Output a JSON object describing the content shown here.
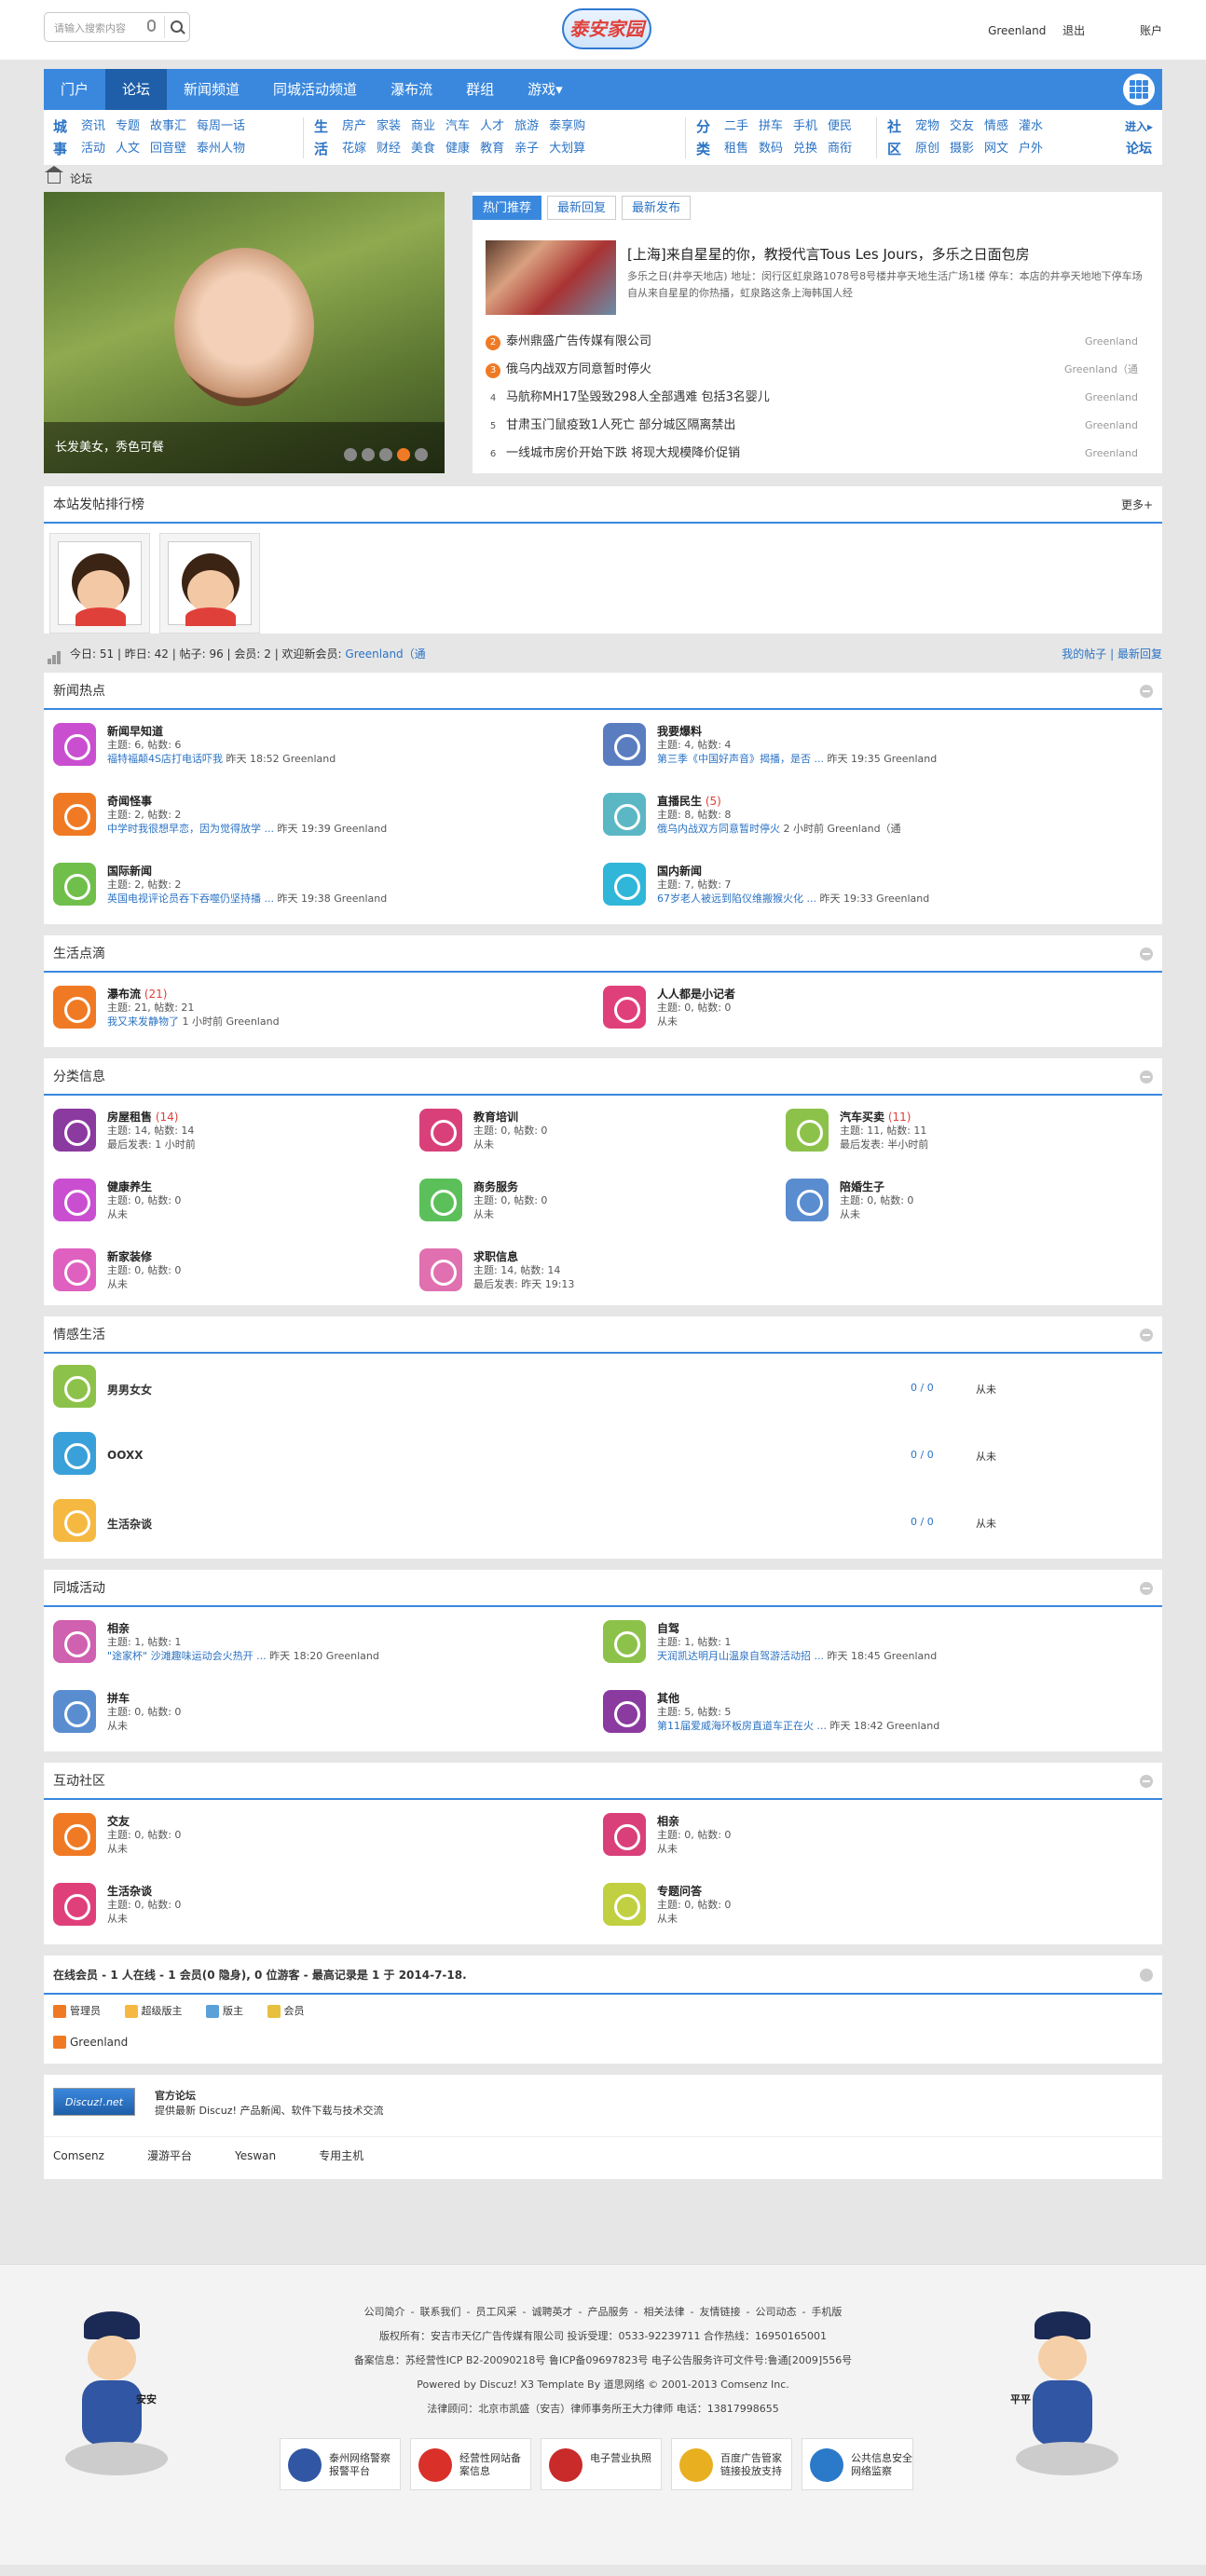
{
  "header": {
    "search_placeholder": "请输入搜索内容",
    "logo": "泰安家园",
    "user": "Greenland",
    "logout": "退出",
    "account": "账户"
  },
  "nav": {
    "items": [
      "门户",
      "论坛",
      "新闻频道",
      "同城活动频道",
      "瀑布流",
      "群组",
      "游戏▾"
    ],
    "active": 1
  },
  "subnav": [
    {
      "label": [
        "城",
        "事"
      ],
      "rows": [
        [
          "资讯",
          "专题",
          "故事汇",
          "每周一话"
        ],
        [
          "活动",
          "人文",
          "回音壁",
          "泰州人物"
        ]
      ]
    },
    {
      "label": [
        "生",
        "活"
      ],
      "rows": [
        [
          "房产",
          "家装",
          "商业",
          "汽车",
          "人才",
          "旅游",
          "泰享购"
        ],
        [
          "花嫁",
          "财经",
          "美食",
          "健康",
          "教育",
          "亲子",
          "大划算"
        ]
      ]
    },
    {
      "label": [
        "分",
        "类"
      ],
      "rows": [
        [
          "二手",
          "拼车",
          "手机",
          "便民"
        ],
        [
          "租售",
          "数码",
          "兑换",
          "商衔"
        ]
      ]
    },
    {
      "label": [
        "社",
        "区"
      ],
      "rows": [
        [
          "宠物",
          "交友",
          "情感",
          "灌水"
        ],
        [
          "原创",
          "摄影",
          "网文",
          "户外"
        ]
      ]
    }
  ],
  "subnav_extra": [
    "进入▸",
    "论坛"
  ],
  "breadcrumb": "论坛",
  "slide": {
    "caption": "长发美女，秀色可餐"
  },
  "hot": {
    "tabs": [
      "热门推荐",
      "最新回复",
      "最新发布"
    ],
    "feature_title": "[上海]来自星星的你，教授代言Tous Les Jours，多乐之日面包房",
    "feature_desc": "多乐之日(井亭天地店) 地址：闵行区虹泉路1078号8号楼井亭天地生活广场1楼 停车：本店的井亭天地地下停车场 自从来自星星的你热播，虹泉路这条上海韩国人经",
    "list": [
      {
        "n": "2",
        "title": "泰州鼎盛广告传媒有限公司",
        "author": "Greenland"
      },
      {
        "n": "3",
        "title": "俄乌内战双方同意暂时停火",
        "author": "Greenland（通"
      },
      {
        "n": "4",
        "title": "马航称MH17坠毁致298人全部遇难 包括3名婴儿",
        "author": "Greenland"
      },
      {
        "n": "5",
        "title": "甘肃玉门鼠疫致1人死亡 部分城区隔离禁出",
        "author": "Greenland"
      },
      {
        "n": "6",
        "title": "一线城市房价开始下跌 将现大规模降价促销",
        "author": "Greenland"
      }
    ]
  },
  "rank": {
    "title": "本站发帖排行榜",
    "more": "更多+"
  },
  "stats": {
    "text": "今日: 51 | 昨日: 42 | 帖子: 96 | 会员: 2 | 欢迎新会员: ",
    "member": "Greenland（通",
    "my": "我的帖子",
    "latest": "最新回复"
  },
  "news": {
    "title": "新闻热点",
    "items": [
      {
        "name": "新闻早知道",
        "stat": "主题: 6, 帖数: 6",
        "last": "福特福颠4S店打电话吓我",
        "time": " 昨天 18:52 Greenland",
        "color": "#c94fd0"
      },
      {
        "name": "我要爆料",
        "stat": "主题: 4, 帖数: 4",
        "last": "第三季《中国好声音》揭播，是否 ...",
        "time": " 昨天 19:35 Greenland",
        "color": "#5a7dc0"
      },
      {
        "name": "奇闻怪事",
        "stat": "主题: 2, 帖数: 2",
        "last": "中学时我很想早恋，因为觉得放学 ...",
        "time": " 昨天 19:39 Greenland",
        "color": "#f07a24"
      },
      {
        "name": "直播民生",
        "count": " (5)",
        "stat": "主题: 8, 帖数: 8",
        "last": "俄乌内战双方同意暂时停火",
        "time": " 2 小时前 Greenland（通",
        "color": "#5cb7c5"
      },
      {
        "name": "国际新闻",
        "stat": "主题: 2, 帖数: 2",
        "last": "英国电视评论员吞下吞噬仍坚持播 ...",
        "time": " 昨天 19:38 Greenland",
        "color": "#6fbf4a"
      },
      {
        "name": "国内新闻",
        "stat": "主题: 7, 帖数: 7",
        "last": "67岁老人被远到陷仪维搬猴火化 ...",
        "time": " 昨天 19:33 Greenland",
        "color": "#2fb6d9"
      }
    ]
  },
  "life": {
    "title": "生活点滴",
    "items": [
      {
        "name": "瀑布流",
        "count": " (21)",
        "stat": "主题: 21, 帖数: 21",
        "last": "我又来发静物了",
        "time": " 1 小时前 Greenland",
        "color": "#f07a24"
      },
      {
        "name": "人人都是小记者",
        "stat": "主题: 0, 帖数: 0",
        "last": "",
        "time": "从未",
        "color": "#e0407a"
      }
    ]
  },
  "class": {
    "title": "分类信息",
    "items": [
      {
        "name": "房屋租售",
        "count": " (14)",
        "stat": "主题: 14, 帖数: 14",
        "time": "最后发表: 1 小时前",
        "color": "#8b3aa0"
      },
      {
        "name": "教育培训",
        "stat": "主题: 0, 帖数: 0",
        "time": "从未",
        "color": "#d9407a"
      },
      {
        "name": "汽车买卖",
        "count": " (11)",
        "stat": "主题: 11, 帖数: 11",
        "time": "最后发表: 半小时前",
        "color": "#8dc24a"
      },
      {
        "name": "健康养生",
        "stat": "主题: 0, 帖数: 0",
        "time": "从未",
        "color": "#c94fd0"
      },
      {
        "name": "商务服务",
        "stat": "主题: 0, 帖数: 0",
        "time": "从未",
        "color": "#5cc05a"
      },
      {
        "name": "陪婚生子",
        "stat": "主题: 0, 帖数: 0",
        "time": "从未",
        "color": "#5a8dd0"
      },
      {
        "name": "新家装修",
        "stat": "主题: 0, 帖数: 0",
        "time": "从未",
        "color": "#e060c0"
      },
      {
        "name": "求职信息",
        "stat": "主题: 14, 帖数: 14",
        "time": "最后发表: 昨天 19:13",
        "color": "#e070b0"
      }
    ]
  },
  "emotion": {
    "title": "情感生活",
    "items": [
      {
        "name": "男男女女",
        "cnt": "0 / 0",
        "nv": "从未",
        "color": "#8dc24a"
      },
      {
        "name": "OOXX",
        "cnt": "0 / 0",
        "nv": "从未",
        "color": "#3aa0d9"
      },
      {
        "name": "生活杂谈",
        "cnt": "0 / 0",
        "nv": "从未",
        "color": "#f5b942"
      }
    ]
  },
  "city": {
    "title": "同城活动",
    "items": [
      {
        "name": "相亲",
        "stat": "主题: 1, 帖数: 1",
        "last": "\"途家杯\" 沙滩趣味运动会火热开 ...",
        "time": " 昨天 18:20 Greenland",
        "color": "#d060b0"
      },
      {
        "name": "自驾",
        "stat": "主题: 1, 帖数: 1",
        "last": "天润凯达明月山温泉自驾游活动招 ...",
        "time": " 昨天 18:45 Greenland",
        "color": "#8dc24a"
      },
      {
        "name": "拼车",
        "stat": "主题: 0, 帖数: 0",
        "last": "",
        "time": "从未",
        "color": "#5a8dd0"
      },
      {
        "name": "其他",
        "stat": "主题: 5, 帖数: 5",
        "last": "第11届爱威海环板房直道车正在火 ...",
        "time": " 昨天 18:42 Greenland",
        "color": "#8b3aa0"
      }
    ]
  },
  "community": {
    "title": "互动社区",
    "items": [
      {
        "name": "交友",
        "stat": "主题: 0, 帖数: 0",
        "time": "从未",
        "color": "#f07a24"
      },
      {
        "name": "相亲",
        "stat": "主题: 0, 帖数: 0",
        "time": "从未",
        "color": "#d9407a"
      },
      {
        "name": "生活杂谈",
        "stat": "主题: 0, 帖数: 0",
        "time": "从未",
        "color": "#e0407a"
      },
      {
        "name": "专题问答",
        "stat": "主题: 0, 帖数: 0",
        "time": "从未",
        "color": "#c0d040"
      }
    ]
  },
  "online": {
    "title": "在线会员 - 1 人在线 - 1 会员(0 隐身), 0 位游客 - 最高记录是 1 于 2014-7-18.",
    "legend": [
      "管理员",
      "超级版主",
      "版主",
      "会员"
    ],
    "user": "Greenland"
  },
  "links": {
    "logo": "Discuz!.net",
    "name": "官方论坛",
    "desc": "提供最新 Discuz! 产品新闻、软件下载与技术交流",
    "row": [
      "Comsenz",
      "漫游平台",
      "Yeswan",
      "专用主机"
    ]
  },
  "footer": {
    "links": [
      "公司简介",
      "联系我们",
      "员工风采",
      "诚聘英才",
      "产品服务",
      "相关法律",
      "友情链接",
      "公司动态",
      "手机版"
    ],
    "l2": "版权所有：安吉市天亿广告传媒有限公司 投诉受理：0533-92239711 合作热线：16950165001",
    "l3": "备案信息：苏经营性ICP B2-20090218号 鲁ICP备09697823号 电子公告服务许可文件号:鲁通[2009]556号",
    "l4": "Powered by Discuz! X3 Template By 道思网络 © 2001-2013 Comsenz Inc.",
    "l5": "法律顾问：北京市凯盛（安吉）律师事务所王大力律师 电话：13817998655",
    "badges": [
      "泰州网络警察报警平台",
      "经营性网站备案信息",
      "电子营业执照",
      "百度广告管家链接投放支持",
      "公共信息安全网络监察"
    ],
    "police_left": "安安",
    "police_right": "平平"
  }
}
